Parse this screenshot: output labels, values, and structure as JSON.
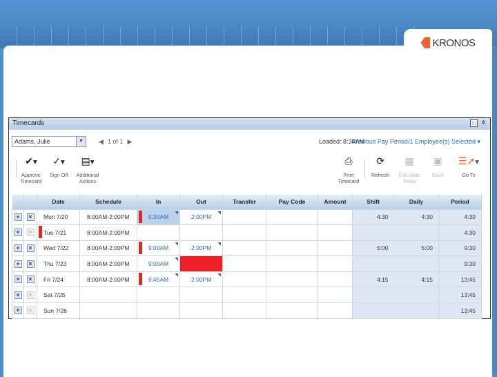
{
  "brand": {
    "logo_text": "KRONOS"
  },
  "panel": {
    "title": "Timecards"
  },
  "toolbar": {
    "employee_select": "Adams, Julie",
    "pager": "1 of 1",
    "loaded": "Loaded: 8:34AM",
    "period": "Previous Pay Period/1 Employee(s) Selected",
    "buttons": [
      {
        "label1": "Approve",
        "label2": "Timecard"
      },
      {
        "label1": "Sign Off",
        "label2": ""
      },
      {
        "label1": "Additional",
        "label2": "Actions"
      },
      {
        "label1": "Print",
        "label2": "Timecard"
      },
      {
        "label1": "Refresh",
        "label2": ""
      },
      {
        "label1": "Calculate",
        "label2": "Totals"
      },
      {
        "label1": "Save",
        "label2": ""
      },
      {
        "label1": "Go To",
        "label2": ""
      }
    ]
  },
  "grid": {
    "headers": [
      "",
      "",
      "Date",
      "Schedule",
      "In",
      "Out",
      "Transfer",
      "Pay Code",
      "Amount",
      "Shift",
      "Daily",
      "Period"
    ],
    "rows": [
      {
        "date": "Mon 7/20",
        "schedule": "8:00AM-2:00PM",
        "in": "9:30AM",
        "out": "2:00PM",
        "shift": "4:30",
        "daily": "4:30",
        "period": "4:30"
      },
      {
        "date": "Tue 7/21",
        "schedule": "8:00AM-2:00PM",
        "in": "",
        "out": "",
        "shift": "",
        "daily": "",
        "period": "4:30"
      },
      {
        "date": "Wed 7/22",
        "schedule": "8:00AM-2:00PM",
        "in": "9:00AM",
        "out": "2:00PM",
        "shift": "5:00",
        "daily": "5:00",
        "period": "9:30"
      },
      {
        "date": "Thu 7/23",
        "schedule": "8:00AM-2:00PM",
        "in": "9:00AM",
        "out": "",
        "shift": "",
        "daily": "",
        "period": "9:30"
      },
      {
        "date": "Fri 7/24",
        "schedule": "8:00AM-2:00PM",
        "in": "9:45AM",
        "out": "2:00PM",
        "shift": "4:15",
        "daily": "4:15",
        "period": "13:45"
      },
      {
        "date": "Sat 7/25",
        "schedule": "",
        "in": "",
        "out": "",
        "shift": "",
        "daily": "",
        "period": "13:45"
      },
      {
        "date": "Sun 7/26",
        "schedule": "",
        "in": "",
        "out": "",
        "shift": "",
        "daily": "",
        "period": "13:45"
      }
    ]
  }
}
